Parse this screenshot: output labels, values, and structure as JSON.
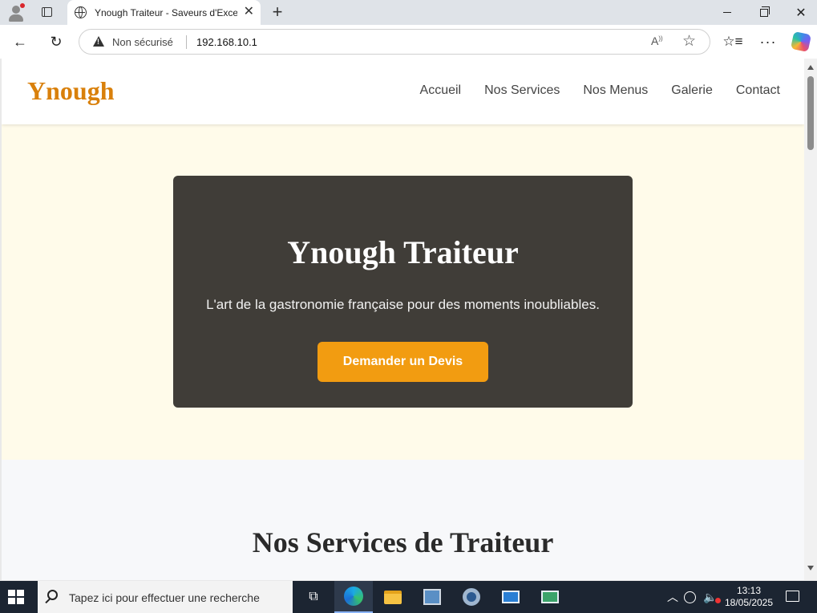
{
  "browser": {
    "tab_title": "Ynough Traiteur - Saveurs d'Exceptio",
    "security_label": "Non sécurisé",
    "url": "192.168.10.1"
  },
  "site": {
    "logo": "Ynough",
    "nav": [
      "Accueil",
      "Nos Services",
      "Nos Menus",
      "Galerie",
      "Contact"
    ],
    "hero": {
      "title": "Ynough Traiteur",
      "subtitle": "L'art de la gastronomie française pour des moments inoubliables.",
      "cta": "Demander un Devis"
    },
    "services_title": "Nos Services de Traiteur"
  },
  "taskbar": {
    "search_placeholder": "Tapez ici pour effectuer une recherche",
    "time": "13:13",
    "date": "18/05/2025"
  },
  "colors": {
    "accent": "#f29c11",
    "logo": "#d9800b",
    "hero_card": "#403d38",
    "hero_bg": "#fffbea"
  }
}
